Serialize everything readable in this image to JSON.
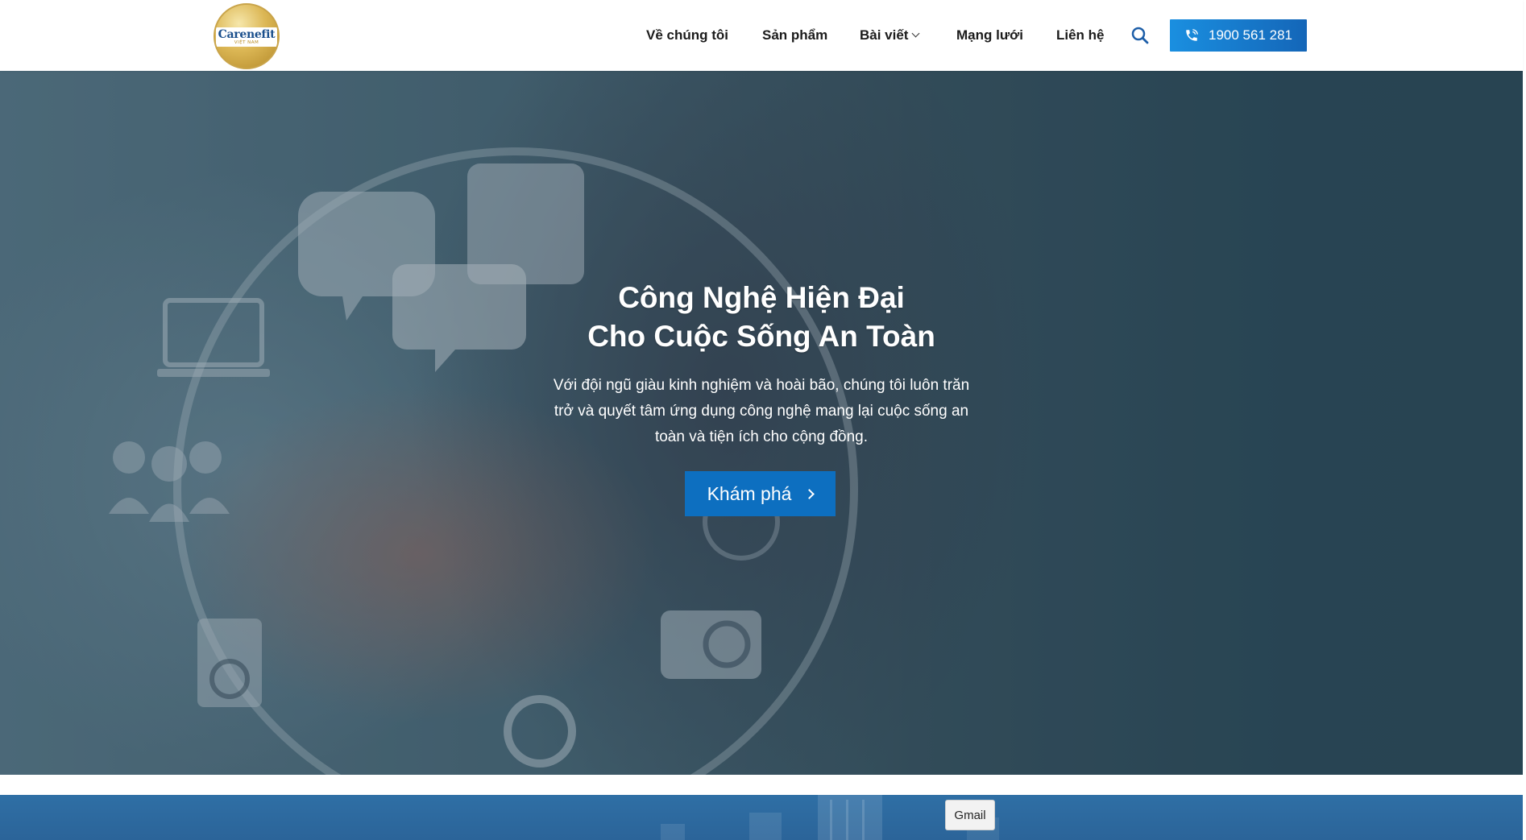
{
  "logo": {
    "text": "Carenefit",
    "subtext": "VIỆT NAM"
  },
  "nav": {
    "items": [
      {
        "label": "Về chúng tôi"
      },
      {
        "label": "Sản phẩm"
      },
      {
        "label": "Bài viết"
      },
      {
        "label": "Mạng lưới"
      },
      {
        "label": "Liên hệ"
      }
    ],
    "search_icon": "search-icon",
    "phone": {
      "icon": "phone-icon",
      "label": "1900 561 281"
    }
  },
  "hero": {
    "title_line1": "Công Nghệ Hiện Đại",
    "title_line2": "Cho Cuộc Sống An Toàn",
    "description": "Với đội ngũ giàu kinh nghiệm và hoài bão, chúng tôi luôn trăn trở và quyết tâm ứng dụng công nghệ mang lại cuộc sống an toàn và tiện ích cho cộng đồng.",
    "cta_label": "Khám phá"
  },
  "floating": {
    "gmail_label": "Gmail"
  },
  "colors": {
    "primary": "#0d6fc0",
    "phone_gradient_start": "#1a8fe0",
    "phone_gradient_end": "#1466b8",
    "hero_base": "#2e4d5c",
    "band": "#2f6fa5"
  }
}
